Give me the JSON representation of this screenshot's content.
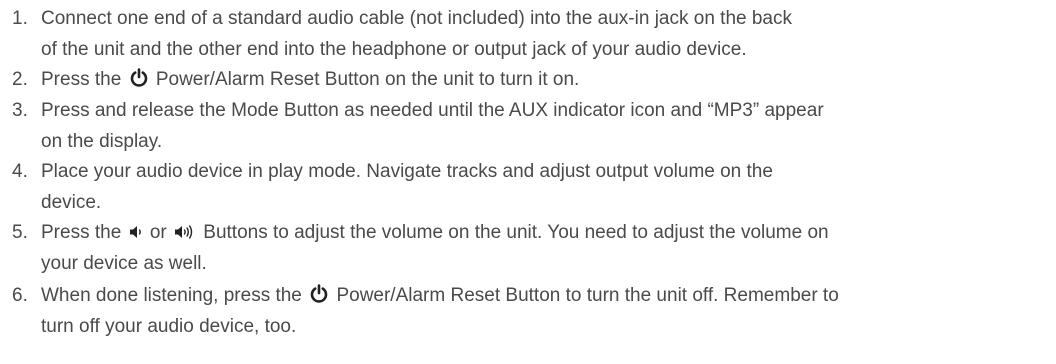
{
  "steps": [
    {
      "number": "1.",
      "lines": [
        "Connect one end of a standard audio cable (not included) into the aux-in jack on the back",
        "of the unit and the other end into the headphone or output jack of your audio device."
      ]
    },
    {
      "number": "2.",
      "before_icon": "Press the ",
      "icon": "power-icon",
      "after_icon": " Power/Alarm Reset Button on the unit to turn it on."
    },
    {
      "number": "3.",
      "lines": [
        "Press and release the Mode Button as needed until the AUX indicator icon and “MP3” appear",
        "on the display."
      ]
    },
    {
      "number": "4.",
      "lines": [
        "Place your audio device in play mode. Navigate tracks and adjust output volume on the",
        "device."
      ]
    },
    {
      "number": "5.",
      "before_icon": "Press the ",
      "icon_1": "volume-down-icon",
      "middle": " or ",
      "icon_2": "volume-up-icon",
      "after_icon": " Buttons to adjust the volume on the unit. You need to adjust the volume on",
      "line2": "your device as well."
    },
    {
      "number": "6.",
      "before_icon": "When done listening, press the ",
      "icon": "power-icon",
      "after_icon": " Power/Alarm Reset Button to turn the unit off. Remember to",
      "line2": "turn off your audio device, too."
    }
  ],
  "colors": {
    "text": "#4a4a4a",
    "background": "#ffffff"
  }
}
